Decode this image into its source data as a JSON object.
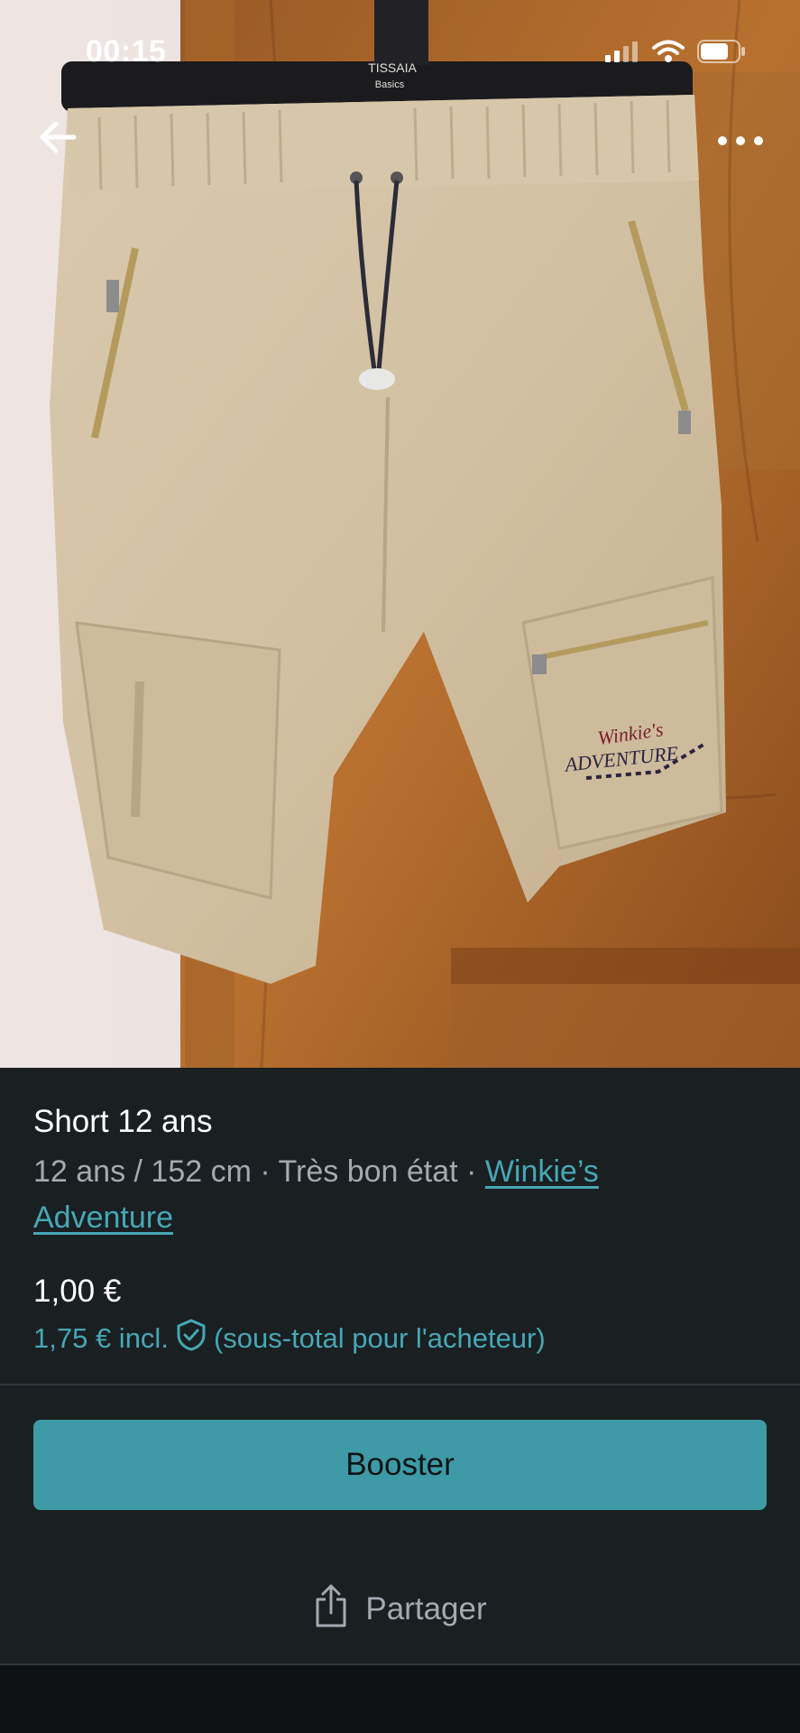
{
  "status_bar": {
    "time": "00:15"
  },
  "photo": {
    "hanger_brand": "TISSAIA",
    "hanger_sub": "Basics",
    "embroidery_top": "Winkie's",
    "embroidery_main": "ADVENTURE"
  },
  "product": {
    "title": "Short 12 ans",
    "size": "12 ans / 152 cm",
    "separator": " · ",
    "condition": "Très bon état",
    "brand_link": "Winkie’s Adventure"
  },
  "price": {
    "amount": "1,00 €",
    "incl_amount": "1,75 € incl.",
    "incl_note": "(sous-total pour l'acheteur)"
  },
  "actions": {
    "boost_label": "Booster",
    "share_label": "Partager"
  },
  "colors": {
    "background": "#1a1f22",
    "accent": "#46a8b4",
    "button": "#3e9aa6",
    "muted_text": "#a3abb1"
  },
  "icons": [
    "back-arrow-icon",
    "more-dots-icon",
    "shield-check-icon",
    "share-icon",
    "wifi-icon",
    "signal-icon",
    "battery-icon"
  ]
}
